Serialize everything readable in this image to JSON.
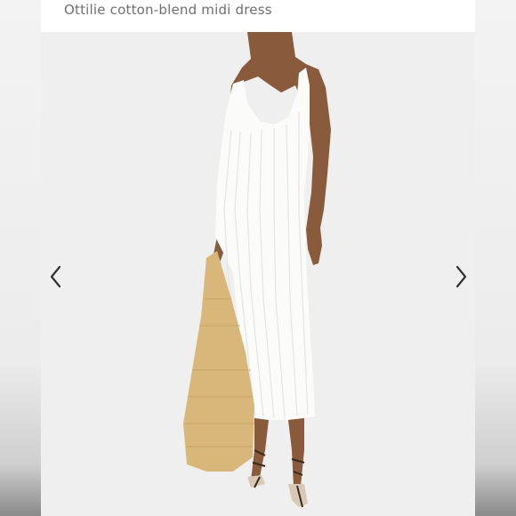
{
  "product": {
    "title": "Ottilie cotton-blend midi dress"
  },
  "gallery": {
    "prev_icon": "chevron-left-icon",
    "next_icon": "chevron-right-icon"
  },
  "colors": {
    "title_text": "#6f6f6f",
    "photo_background": "#efefef",
    "dress": "#fbfbf9",
    "bag": "#d9b77a",
    "skin": "#8a5a3c",
    "arrow": "#333333"
  }
}
